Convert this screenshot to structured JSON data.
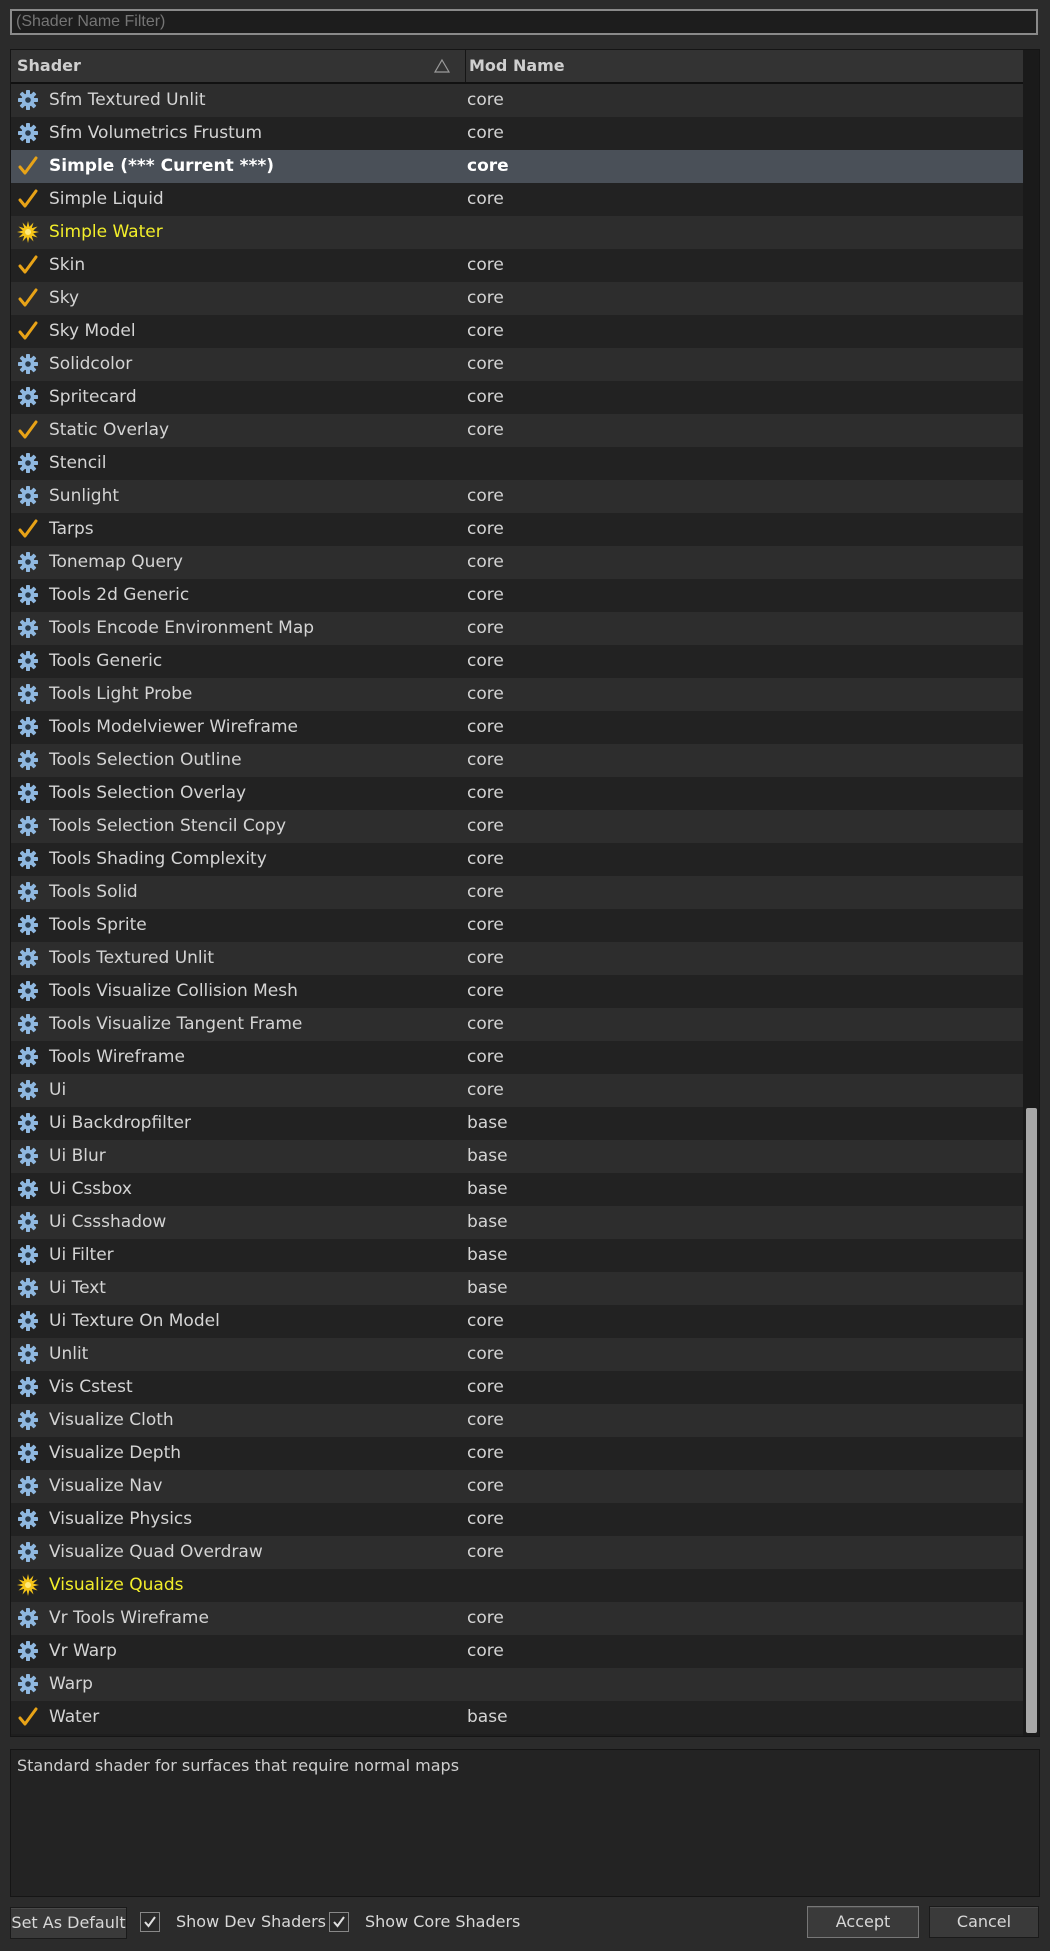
{
  "filter": {
    "placeholder": "(Shader Name Filter)"
  },
  "table": {
    "columns": {
      "shader": "Shader",
      "mod": "Mod Name"
    },
    "rows": [
      {
        "name": "Sfm Textured Unlit",
        "mod": "core",
        "icon": "gear-icon"
      },
      {
        "name": "Sfm Volumetrics Frustum",
        "mod": "core",
        "icon": "gear-icon"
      },
      {
        "name": "Simple  (*** Current ***)",
        "mod": "core",
        "icon": "checkmark-icon",
        "current": true
      },
      {
        "name": "Simple Liquid",
        "mod": "core",
        "icon": "checkmark-icon"
      },
      {
        "name": "Simple Water",
        "mod": "",
        "icon": "sun-icon",
        "highlight": true
      },
      {
        "name": "Skin",
        "mod": "core",
        "icon": "checkmark-icon"
      },
      {
        "name": "Sky",
        "mod": "core",
        "icon": "checkmark-icon"
      },
      {
        "name": "Sky Model",
        "mod": "core",
        "icon": "checkmark-icon"
      },
      {
        "name": "Solidcolor",
        "mod": "core",
        "icon": "gear-icon"
      },
      {
        "name": "Spritecard",
        "mod": "core",
        "icon": "gear-icon"
      },
      {
        "name": "Static Overlay",
        "mod": "core",
        "icon": "checkmark-icon"
      },
      {
        "name": "Stencil",
        "mod": "",
        "icon": "gear-icon"
      },
      {
        "name": "Sunlight",
        "mod": "core",
        "icon": "gear-icon"
      },
      {
        "name": "Tarps",
        "mod": "core",
        "icon": "checkmark-icon"
      },
      {
        "name": "Tonemap Query",
        "mod": "core",
        "icon": "gear-icon"
      },
      {
        "name": "Tools 2d Generic",
        "mod": "core",
        "icon": "gear-icon"
      },
      {
        "name": "Tools Encode Environment Map",
        "mod": "core",
        "icon": "gear-icon"
      },
      {
        "name": "Tools Generic",
        "mod": "core",
        "icon": "gear-icon"
      },
      {
        "name": "Tools Light Probe",
        "mod": "core",
        "icon": "gear-icon"
      },
      {
        "name": "Tools Modelviewer Wireframe",
        "mod": "core",
        "icon": "gear-icon"
      },
      {
        "name": "Tools Selection Outline",
        "mod": "core",
        "icon": "gear-icon"
      },
      {
        "name": "Tools Selection Overlay",
        "mod": "core",
        "icon": "gear-icon"
      },
      {
        "name": "Tools Selection Stencil Copy",
        "mod": "core",
        "icon": "gear-icon"
      },
      {
        "name": "Tools Shading Complexity",
        "mod": "core",
        "icon": "gear-icon"
      },
      {
        "name": "Tools Solid",
        "mod": "core",
        "icon": "gear-icon"
      },
      {
        "name": "Tools Sprite",
        "mod": "core",
        "icon": "gear-icon"
      },
      {
        "name": "Tools Textured Unlit",
        "mod": "core",
        "icon": "gear-icon"
      },
      {
        "name": "Tools Visualize Collision Mesh",
        "mod": "core",
        "icon": "gear-icon"
      },
      {
        "name": "Tools Visualize Tangent Frame",
        "mod": "core",
        "icon": "gear-icon"
      },
      {
        "name": "Tools Wireframe",
        "mod": "core",
        "icon": "gear-icon"
      },
      {
        "name": "Ui",
        "mod": "core",
        "icon": "gear-icon"
      },
      {
        "name": "Ui Backdropfilter",
        "mod": "base",
        "icon": "gear-icon"
      },
      {
        "name": "Ui Blur",
        "mod": "base",
        "icon": "gear-icon"
      },
      {
        "name": "Ui Cssbox",
        "mod": "base",
        "icon": "gear-icon"
      },
      {
        "name": "Ui Cssshadow",
        "mod": "base",
        "icon": "gear-icon"
      },
      {
        "name": "Ui Filter",
        "mod": "base",
        "icon": "gear-icon"
      },
      {
        "name": "Ui Text",
        "mod": "base",
        "icon": "gear-icon"
      },
      {
        "name": "Ui Texture On Model",
        "mod": "core",
        "icon": "gear-icon"
      },
      {
        "name": "Unlit",
        "mod": "core",
        "icon": "gear-icon"
      },
      {
        "name": "Vis Cstest",
        "mod": "core",
        "icon": "gear-icon"
      },
      {
        "name": "Visualize Cloth",
        "mod": "core",
        "icon": "gear-icon"
      },
      {
        "name": "Visualize Depth",
        "mod": "core",
        "icon": "gear-icon"
      },
      {
        "name": "Visualize Nav",
        "mod": "core",
        "icon": "gear-icon"
      },
      {
        "name": "Visualize Physics",
        "mod": "core",
        "icon": "gear-icon"
      },
      {
        "name": "Visualize Quad Overdraw",
        "mod": "core",
        "icon": "gear-icon"
      },
      {
        "name": "Visualize Quads",
        "mod": "",
        "icon": "sun-icon",
        "highlight": true
      },
      {
        "name": "Vr Tools Wireframe",
        "mod": "core",
        "icon": "gear-icon"
      },
      {
        "name": "Vr Warp",
        "mod": "core",
        "icon": "gear-icon"
      },
      {
        "name": "Warp",
        "mod": "",
        "icon": "gear-icon"
      },
      {
        "name": "Water",
        "mod": "base",
        "icon": "checkmark-icon"
      }
    ]
  },
  "description": "Standard shader for surfaces that require normal maps",
  "footer": {
    "set_default": "Set As Default",
    "show_dev": "Show Dev Shaders",
    "show_core": "Show Core Shaders",
    "accept": "Accept",
    "cancel": "Cancel"
  },
  "colors": {
    "highlight_text": "#f2ee2a",
    "checkmark": "#e8a317",
    "gear": "#8fb8e0",
    "sun": "#f5c518"
  }
}
